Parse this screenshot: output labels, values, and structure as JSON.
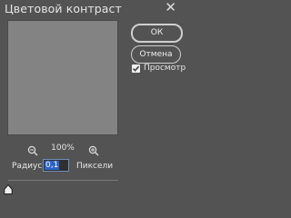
{
  "window": {
    "title": "Цветовой контраст"
  },
  "buttons": {
    "ok": "ОК",
    "cancel": "Отмена"
  },
  "preview_toggle": {
    "label": "Просмотр",
    "checked": true
  },
  "zoom": {
    "level": "100%"
  },
  "radius": {
    "label": "Радиус:",
    "value": "0,1",
    "units": "Пиксели"
  },
  "icons": {
    "close": "close-icon",
    "zoom_out": "zoom-out-icon",
    "zoom_in": "zoom-in-icon",
    "check": "checkmark-icon",
    "slider": "slider-handle-icon"
  }
}
